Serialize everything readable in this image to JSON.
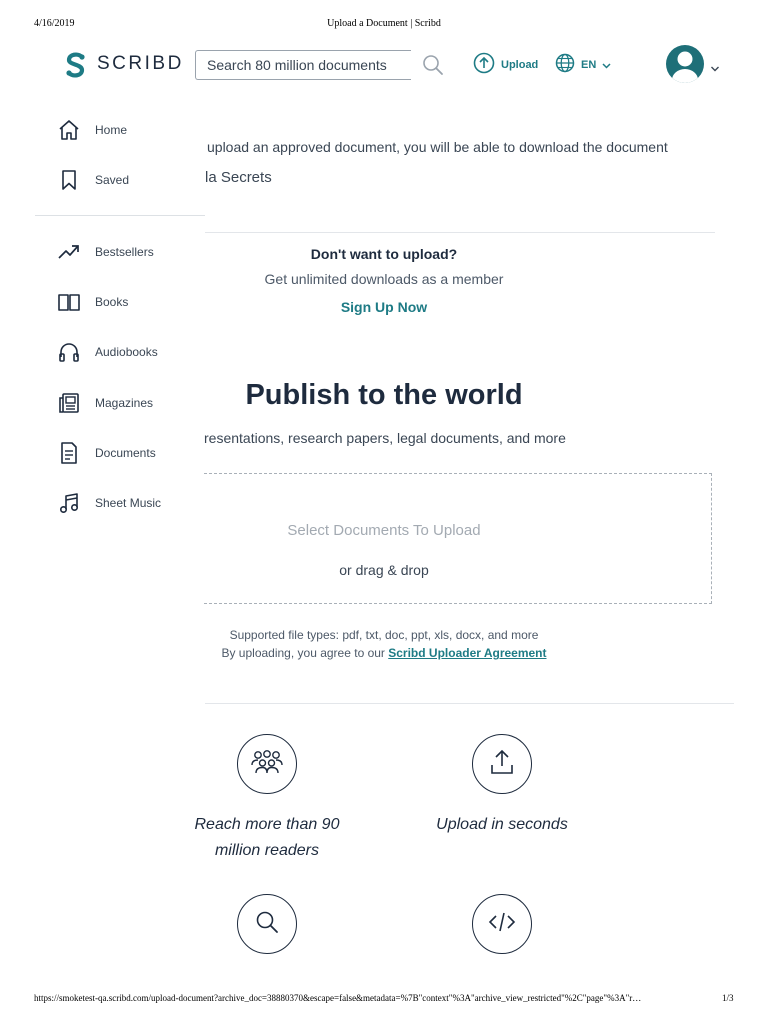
{
  "print": {
    "date": "4/16/2019",
    "title": "Upload a Document | Scribd",
    "url": "https://smoketest-qa.scribd.com/upload-document?archive_doc=38880370&escape=false&metadata=%7B\"context\"%3A\"archive_view_restricted\"%2C\"page\"%3A\"r…",
    "page": "1/3"
  },
  "header": {
    "logo_text": "SCRIBD",
    "search_placeholder": "Search 80 million documents",
    "upload_label": "Upload",
    "language_label": "EN"
  },
  "sidebar": {
    "items": [
      {
        "label": "Home",
        "icon": "home-icon"
      },
      {
        "label": "Saved",
        "icon": "bookmark-icon"
      },
      {
        "label": "Bestsellers",
        "icon": "trending-icon"
      },
      {
        "label": "Books",
        "icon": "book-icon"
      },
      {
        "label": "Audiobooks",
        "icon": "headphones-icon"
      },
      {
        "label": "Magazines",
        "icon": "magazine-icon"
      },
      {
        "label": "Documents",
        "icon": "document-icon"
      },
      {
        "label": "Sheet Music",
        "icon": "music-icon"
      }
    ]
  },
  "main": {
    "intro_line": "upload an approved document, you will be able to download the document",
    "doc_title": "la Secrets",
    "dont_upload": {
      "heading": "Don't want to upload?",
      "subtext": "Get unlimited downloads as a member",
      "cta": "Sign Up Now"
    },
    "publish": {
      "title": "Publish to the world",
      "subtitle": "resentations, research papers, legal documents, and more"
    },
    "dropzone": {
      "select_label": "Select Documents To Upload",
      "drag_label": "or drag & drop"
    },
    "file_types": "Supported file types: pdf, txt, doc, ppt, xls, docx, and more",
    "agreement_prefix": "By uploading, you agree to our ",
    "agreement_link": "Scribd Uploader Agreement",
    "features": [
      {
        "icon": "people-icon",
        "line1": "Reach more than 90",
        "line2": "million readers"
      },
      {
        "icon": "upload-icon",
        "line1": "Upload in seconds",
        "line2": ""
      },
      {
        "icon": "search-icon",
        "line1": "",
        "line2": ""
      },
      {
        "icon": "code-icon",
        "line1": "",
        "line2": ""
      }
    ]
  },
  "colors": {
    "brand_teal": "#1e7b85",
    "text_dark": "#1e2b3e",
    "logo_mark": "#1e7b85"
  }
}
